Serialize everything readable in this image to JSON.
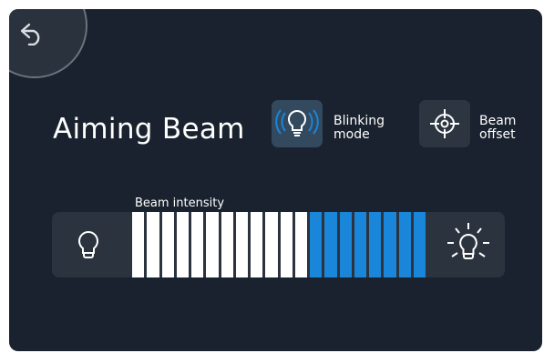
{
  "title": "Aiming Beam",
  "back_icon": "undo-arrow-icon",
  "buttons": {
    "blinking": {
      "icon": "blinking-bulb-icon",
      "label_line1": "Blinking",
      "label_line2": "mode",
      "active": true
    },
    "offset": {
      "icon": "crosshair-icon",
      "label_line1": "Beam",
      "label_line2": "offset"
    }
  },
  "intensity": {
    "label": "Beam intensity",
    "decrease_icon": "dim-bulb-icon",
    "increase_icon": "bright-bulb-icon",
    "total_segments": 20,
    "white_segments": 12,
    "blue_segments": 8
  },
  "colors": {
    "background": "#19222e",
    "panel": "#2b333e",
    "accent": "#1a86d9",
    "text": "#ffffff"
  }
}
